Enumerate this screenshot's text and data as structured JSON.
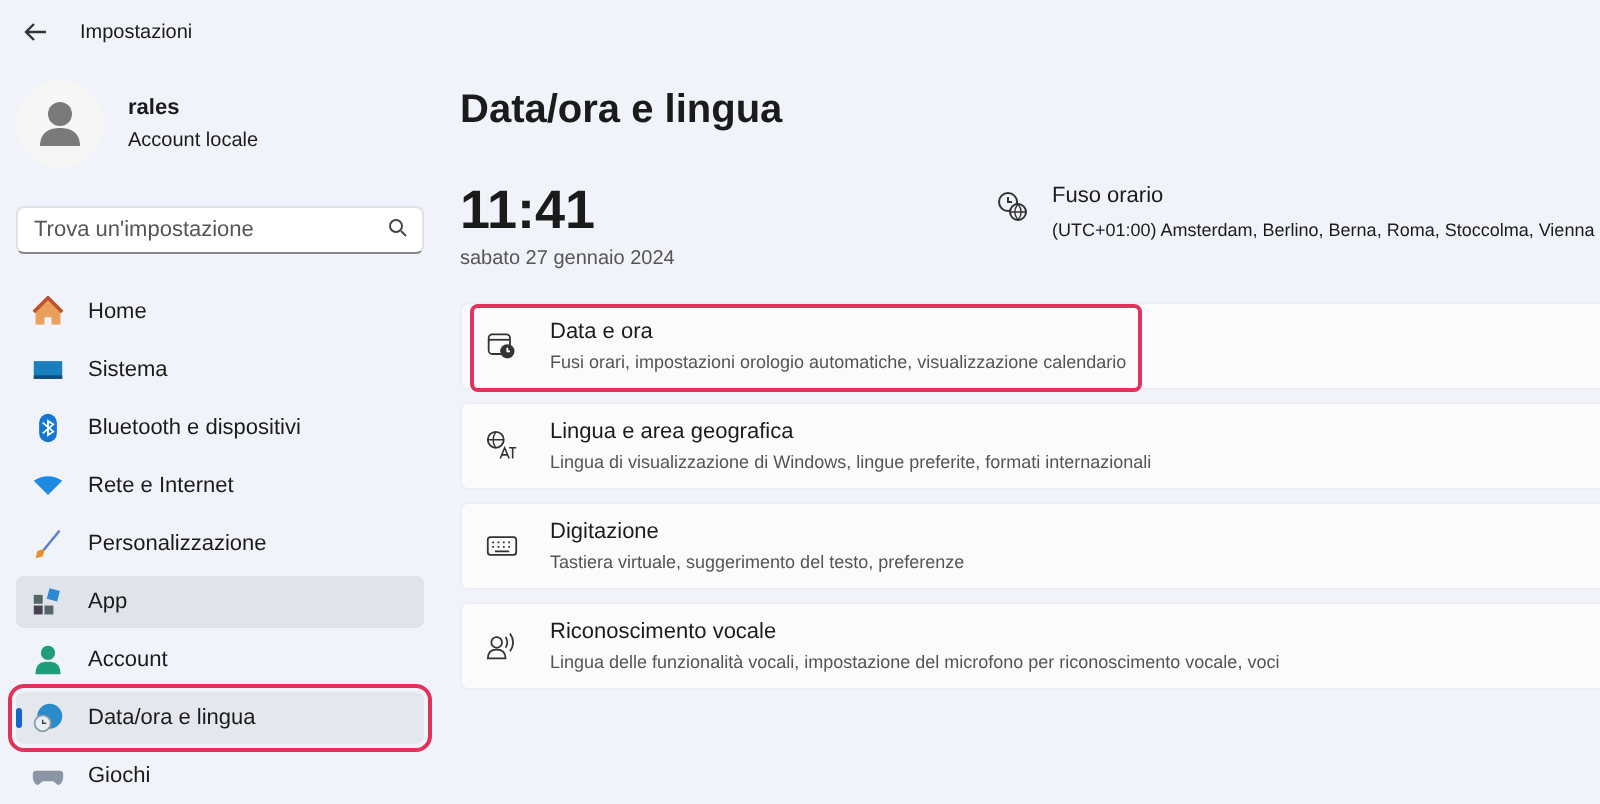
{
  "window": {
    "title": "Impostazioni"
  },
  "user": {
    "name": "rales",
    "account": "Account locale"
  },
  "search": {
    "placeholder": "Trova un'impostazione"
  },
  "nav": [
    {
      "kind": "home",
      "label": "Home",
      "selected": false,
      "hovered": false,
      "highlighted": false
    },
    {
      "kind": "system",
      "label": "Sistema",
      "selected": false,
      "hovered": false,
      "highlighted": false
    },
    {
      "kind": "bluetooth",
      "label": "Bluetooth e dispositivi",
      "selected": false,
      "hovered": false,
      "highlighted": false
    },
    {
      "kind": "network",
      "label": "Rete e Internet",
      "selected": false,
      "hovered": false,
      "highlighted": false
    },
    {
      "kind": "brush",
      "label": "Personalizzazione",
      "selected": false,
      "hovered": false,
      "highlighted": false
    },
    {
      "kind": "apps",
      "label": "App",
      "selected": false,
      "hovered": true,
      "highlighted": false
    },
    {
      "kind": "account",
      "label": "Account",
      "selected": false,
      "hovered": false,
      "highlighted": false
    },
    {
      "kind": "time",
      "label": "Data/ora e lingua",
      "selected": true,
      "hovered": false,
      "highlighted": true
    },
    {
      "kind": "games",
      "label": "Giochi",
      "selected": false,
      "hovered": false,
      "highlighted": false
    }
  ],
  "page_title": "Data/ora e lingua",
  "clock": {
    "time": "11:41",
    "date": "sabato 27 gennaio 2024"
  },
  "timezone": {
    "label": "Fuso orario",
    "value": "(UTC+01:00) Amsterdam, Berlino, Berna, Roma, Stoccolma, Vienna"
  },
  "cards": [
    {
      "kind": "calendar",
      "title": "Data e ora",
      "description": "Fusi orari, impostazioni orologio automatiche, visualizzazione calendario",
      "highlighted": true
    },
    {
      "kind": "language",
      "title": "Lingua e area geografica",
      "description": "Lingua di visualizzazione di Windows, lingue preferite, formati internazionali",
      "highlighted": false
    },
    {
      "kind": "keyboard",
      "title": "Digitazione",
      "description": "Tastiera virtuale, suggerimento del testo, preferenze",
      "highlighted": false
    },
    {
      "kind": "speech",
      "title": "Riconoscimento vocale",
      "description": "Lingua delle funzionalità vocali, impostazione del microfono per riconoscimento vocale, voci",
      "highlighted": false
    }
  ]
}
